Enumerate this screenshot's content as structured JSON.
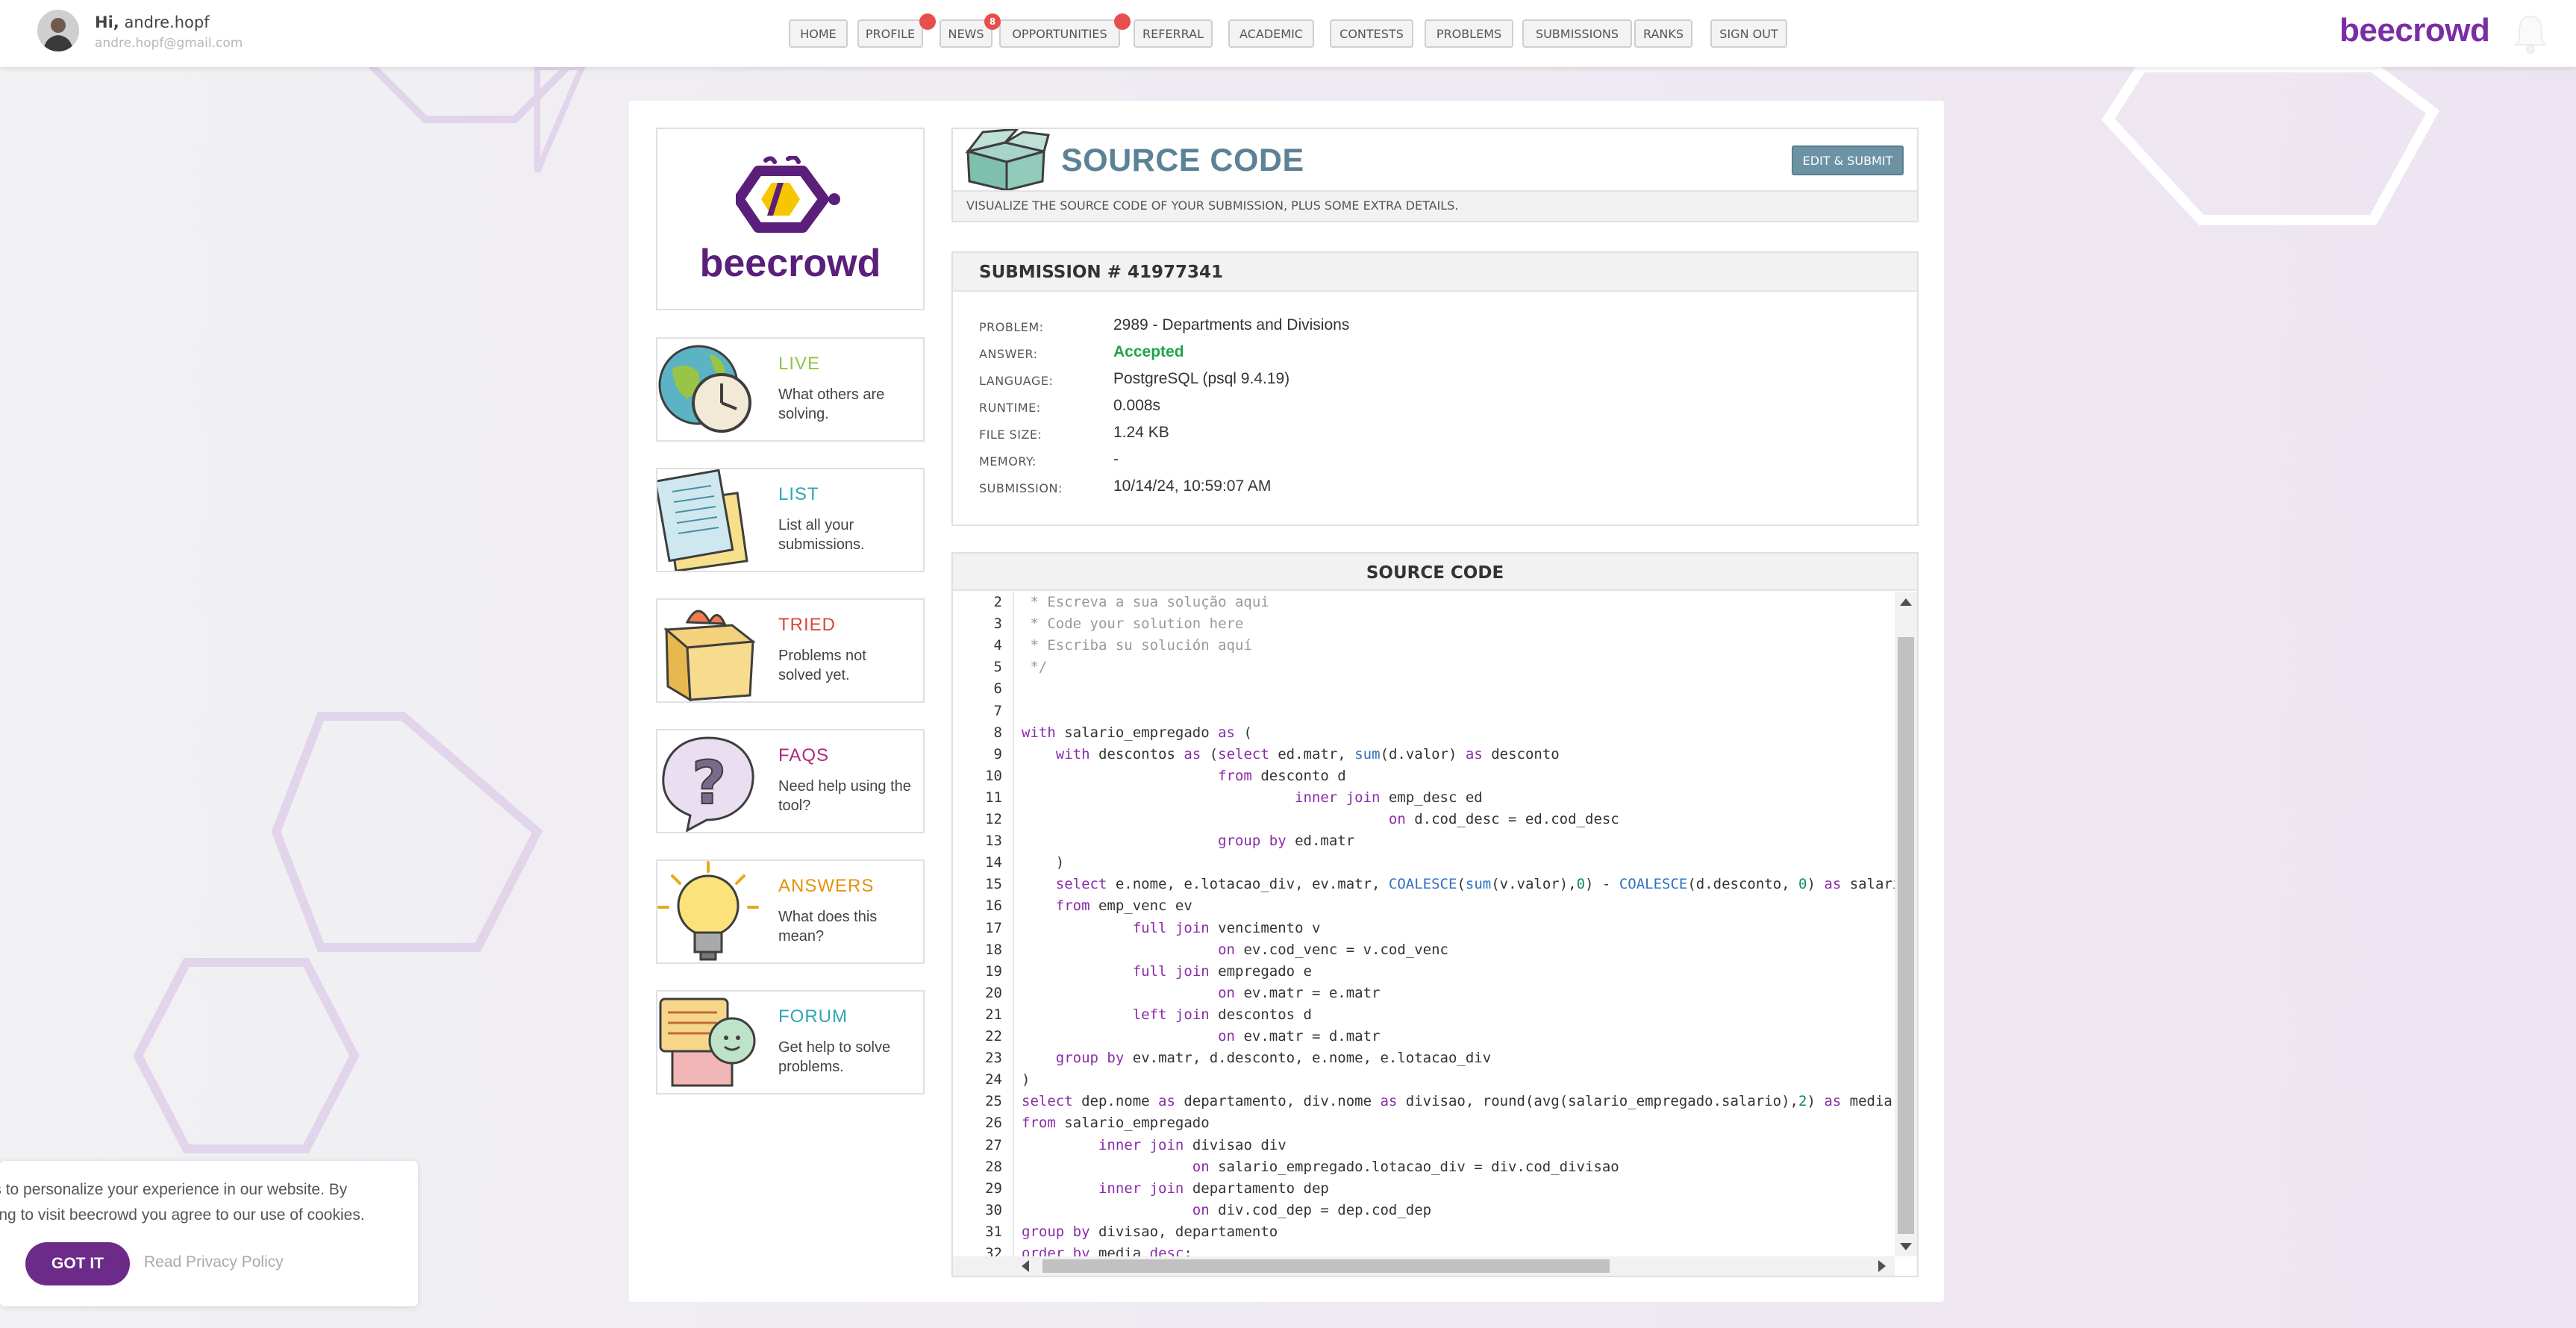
{
  "user": {
    "greeting": "Hi,",
    "name": "andre.hopf",
    "email": "andre.hopf@gmail.com"
  },
  "nav": {
    "items": [
      "HOME",
      "PROFILE",
      "NEWS",
      "OPPORTUNITIES",
      "REFERRAL",
      "ACADEMIC",
      "CONTESTS",
      "PROBLEMS",
      "SUBMISSIONS",
      "RANKS",
      "SIGN OUT"
    ],
    "news_badge": "8"
  },
  "brand": "beecrowd",
  "logo_text": "beecrowd",
  "sidebar": [
    {
      "title": "LIVE",
      "desc": "What others are solving.",
      "color": "#8cc63f"
    },
    {
      "title": "LIST",
      "desc": "List all your submissions.",
      "color": "#2ea7b5"
    },
    {
      "title": "TRIED",
      "desc": "Problems not solved yet.",
      "color": "#d9463b"
    },
    {
      "title": "FAQS",
      "desc": "Need help using the tool?",
      "color": "#b0297c"
    },
    {
      "title": "ANSWERS",
      "desc": "What does this mean?",
      "color": "#e6920c"
    },
    {
      "title": "FORUM",
      "desc": "Get help to solve problems.",
      "color": "#2ea7b5"
    }
  ],
  "header": {
    "title": "SOURCE CODE",
    "subtitle": "VISUALIZE THE SOURCE CODE OF YOUR SUBMISSION, PLUS SOME EXTRA DETAILS.",
    "edit_button": "EDIT & SUBMIT"
  },
  "submission": {
    "title": "SUBMISSION # 41977341",
    "fields": [
      {
        "label": "PROBLEM:",
        "value": "2989 - Departments and Divisions"
      },
      {
        "label": "ANSWER:",
        "value": "Accepted"
      },
      {
        "label": "LANGUAGE:",
        "value": "PostgreSQL (psql 9.4.19)"
      },
      {
        "label": "RUNTIME:",
        "value": "0.008s"
      },
      {
        "label": "FILE SIZE:",
        "value": "1.24 KB"
      },
      {
        "label": "MEMORY:",
        "value": "-"
      },
      {
        "label": "SUBMISSION:",
        "value": "10/14/24, 10:59:07 AM"
      }
    ],
    "accepted_color": "#1fa34a"
  },
  "code": {
    "title": "SOURCE CODE",
    "first_line_number": 2,
    "lines": [
      " * Escreva a sua solução aqui",
      " * Code your solution here",
      " * Escriba su solución aquí",
      " */",
      "",
      "",
      "with salario_empregado as (",
      "    with descontos as (select ed.matr, sum(d.valor) as desconto",
      "                       from desconto d",
      "                                inner join emp_desc ed",
      "                                           on d.cod_desc = ed.cod_desc",
      "                       group by ed.matr",
      "    )",
      "    select e.nome, e.lotacao_div, ev.matr, COALESCE(sum(v.valor),0) - COALESCE(d.desconto, 0) as salario",
      "    from emp_venc ev",
      "             full join vencimento v",
      "                       on ev.cod_venc = v.cod_venc",
      "             full join empregado e",
      "                       on ev.matr = e.matr",
      "             left join descontos d",
      "                       on ev.matr = d.matr",
      "    group by ev.matr, d.desconto, e.nome, e.lotacao_div",
      ")",
      "select dep.nome as departamento, div.nome as divisao, round(avg(salario_empregado.salario),2) as media",
      "from salario_empregado",
      "         inner join divisao div",
      "                    on salario_empregado.lotacao_div = div.cod_divisao",
      "         inner join departamento dep",
      "                    on div.cod_dep = dep.cod_dep",
      "group by divisao, departamento",
      "order by media desc;"
    ]
  },
  "cookie": {
    "text_line1": "Cookies to personalize your experience in our website. By",
    "text_line2": "continuing to visit beecrowd you agree to our use of cookies.",
    "ok": "GOT IT",
    "policy": "Read Privacy Policy"
  }
}
